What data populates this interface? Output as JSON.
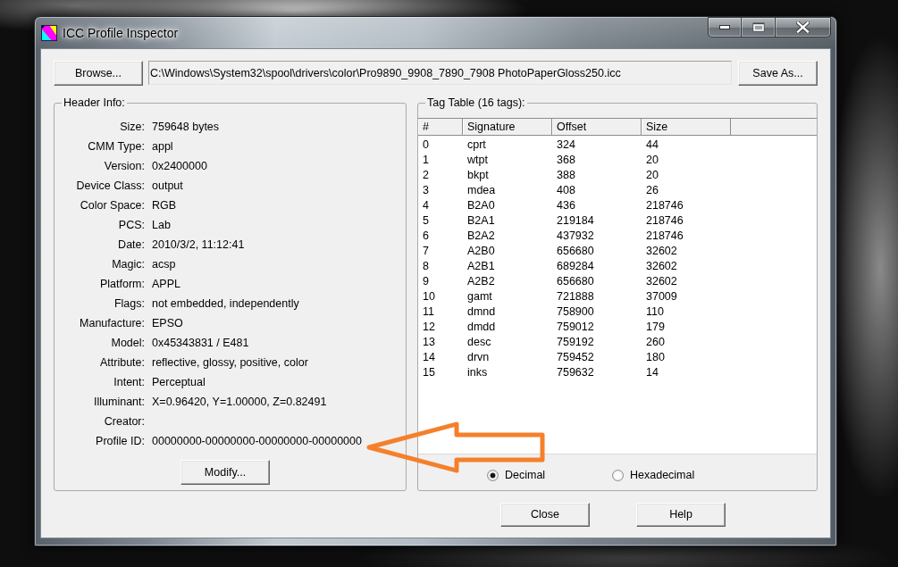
{
  "window": {
    "title": "ICC Profile Inspector"
  },
  "file_bar": {
    "browse_button": "Browse...",
    "path": "C:\\Windows\\System32\\spool\\drivers\\color\\Pro9890_9908_7890_7908 PhotoPaperGloss250.icc",
    "save_button": "Save As..."
  },
  "header_info": {
    "title": "Header Info:",
    "fields": [
      {
        "label": "Size:",
        "value": "759648 bytes"
      },
      {
        "label": "CMM Type:",
        "value": "appl"
      },
      {
        "label": "Version:",
        "value": "0x2400000"
      },
      {
        "label": "Device Class:",
        "value": "output"
      },
      {
        "label": "Color Space:",
        "value": "RGB"
      },
      {
        "label": "PCS:",
        "value": "Lab"
      },
      {
        "label": "Date:",
        "value": "2010/3/2, 11:12:41"
      },
      {
        "label": "Magic:",
        "value": "acsp"
      },
      {
        "label": "Platform:",
        "value": "APPL"
      },
      {
        "label": "Flags:",
        "value": "not embedded, independently"
      },
      {
        "label": "Manufacture:",
        "value": "EPSO"
      },
      {
        "label": "Model:",
        "value": "0x45343831 / E481"
      },
      {
        "label": "Attribute:",
        "value": "reflective, glossy, positive, color"
      },
      {
        "label": "Intent:",
        "value": "Perceptual"
      },
      {
        "label": "Illuminant:",
        "value": "X=0.96420, Y=1.00000, Z=0.82491"
      },
      {
        "label": "Creator:"
      },
      {
        "label": "Profile ID:",
        "value": "00000000-00000000-00000000-00000000"
      }
    ],
    "modify_button": "Modify..."
  },
  "tag_table": {
    "title": "Tag Table (16 tags):",
    "columns": [
      "#",
      "Signature",
      "Offset",
      "Size"
    ],
    "rows": [
      [
        "0",
        "cprt",
        "324",
        "44"
      ],
      [
        "1",
        "wtpt",
        "368",
        "20"
      ],
      [
        "2",
        "bkpt",
        "388",
        "20"
      ],
      [
        "3",
        "mdea",
        "408",
        "26"
      ],
      [
        "4",
        "B2A0",
        "436",
        "218746"
      ],
      [
        "5",
        "B2A1",
        "219184",
        "218746"
      ],
      [
        "6",
        "B2A2",
        "437932",
        "218746"
      ],
      [
        "7",
        "A2B0",
        "656680",
        "32602"
      ],
      [
        "8",
        "A2B1",
        "689284",
        "32602"
      ],
      [
        "9",
        "A2B2",
        "656680",
        "32602"
      ],
      [
        "10",
        "gamt",
        "721888",
        "37009"
      ],
      [
        "11",
        "dmnd",
        "758900",
        "110"
      ],
      [
        "12",
        "dmdd",
        "759012",
        "179"
      ],
      [
        "13",
        "desc",
        "759192",
        "260"
      ],
      [
        "14",
        "drvn",
        "759452",
        "180"
      ],
      [
        "15",
        "inks",
        "759632",
        "14"
      ]
    ]
  },
  "number_format": [
    {
      "label": "Decimal",
      "selected": true
    },
    {
      "label": "Hexadecimal",
      "selected": false
    }
  ],
  "buttons": [
    "Close",
    "Help"
  ]
}
